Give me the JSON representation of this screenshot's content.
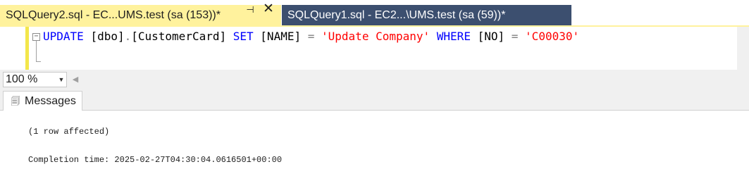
{
  "tabs": [
    {
      "label": "SQLQuery2.sql - EC...UMS.test (sa (153))*",
      "active": true
    },
    {
      "label": "SQLQuery1.sql - EC2...\\UMS.test (sa (59))*",
      "active": false
    }
  ],
  "tab_icons": {
    "pin": "pin-icon",
    "close": "close-icon"
  },
  "editor": {
    "collapse_symbol": "−",
    "tokens": {
      "update": "UPDATE",
      "dbo": "[dbo]",
      "dot": ".",
      "table": "[CustomerCard]",
      "set": "SET",
      "col_name": "[NAME]",
      "eq1": "=",
      "str1": "'Update Company'",
      "where": "WHERE",
      "col_no": "[NO]",
      "eq2": "=",
      "str2": "'C00030'"
    }
  },
  "zoom": {
    "value": "100 %"
  },
  "results": {
    "tab_label": "Messages"
  },
  "messages": {
    "line1": "(1 row affected)",
    "line2": "Completion time: 2025-02-27T04:30:04.0616501+00:00"
  },
  "colors": {
    "active_tab": "#fff29d",
    "inactive_tab": "#3c4f6f",
    "keyword": "#0000ff",
    "string": "#ff0000"
  }
}
